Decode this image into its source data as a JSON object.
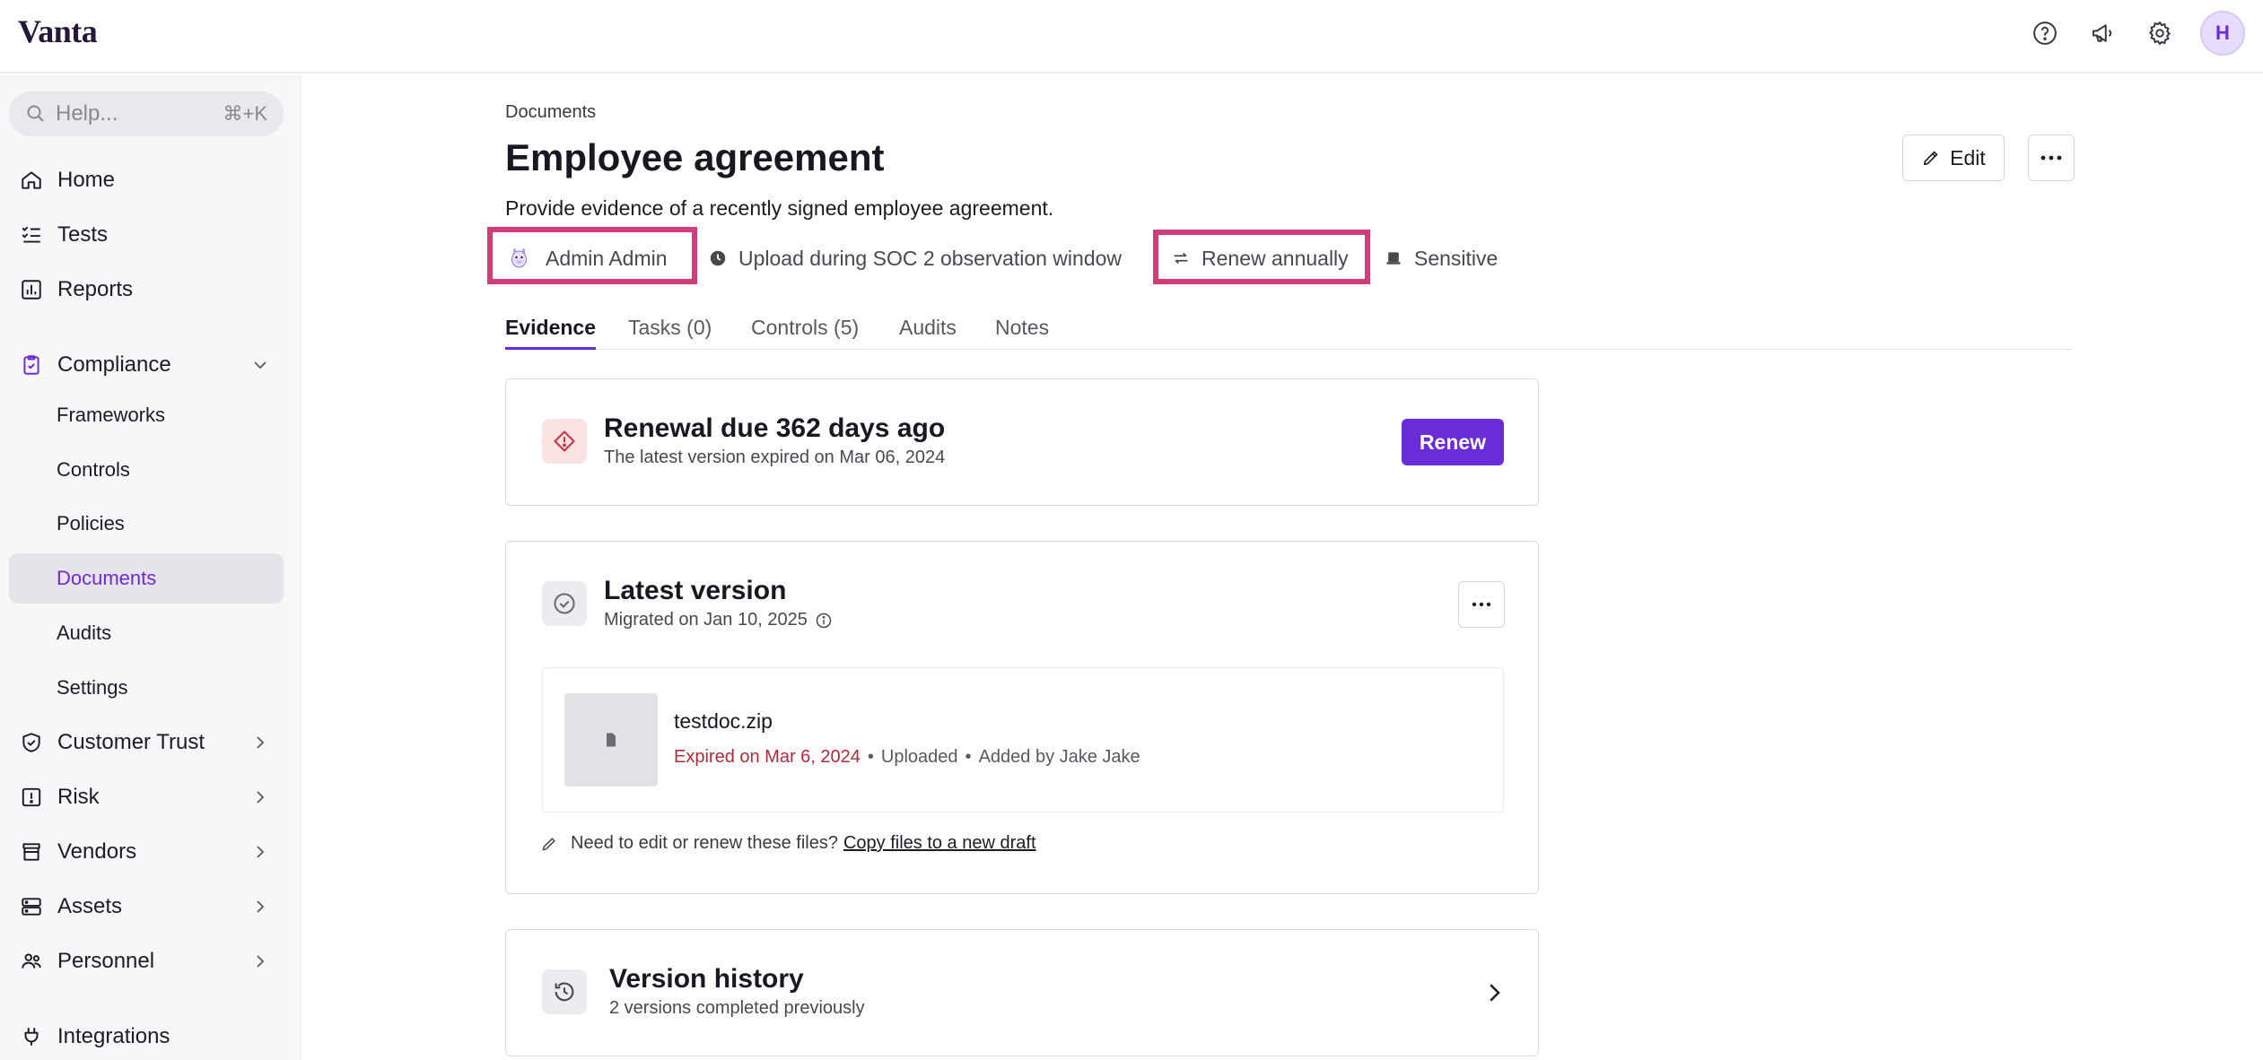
{
  "app": {
    "logo": "Vanta",
    "avatar_initial": "H"
  },
  "topbar": {
    "icons": [
      "help-icon",
      "megaphone-icon",
      "gear-icon"
    ]
  },
  "sidebar": {
    "search": {
      "placeholder": "Help...",
      "shortcut": "⌘+K"
    },
    "items": {
      "home": "Home",
      "tests": "Tests",
      "reports": "Reports",
      "compliance": "Compliance",
      "frameworks": "Frameworks",
      "controls": "Controls",
      "policies": "Policies",
      "documents": "Documents",
      "audits": "Audits",
      "settings": "Settings",
      "customer_trust": "Customer Trust",
      "risk": "Risk",
      "vendors": "Vendors",
      "assets": "Assets",
      "personnel": "Personnel",
      "integrations": "Integrations"
    }
  },
  "page": {
    "breadcrumb": "Documents",
    "title": "Employee agreement",
    "description": "Provide evidence of a recently signed employee agreement.",
    "edit_label": "Edit",
    "meta": {
      "owner": "Admin Admin",
      "upload_window": "Upload during SOC 2 observation window",
      "renewal": "Renew annually",
      "sensitivity": "Sensitive"
    },
    "tabs": [
      "Evidence",
      "Tasks (0)",
      "Controls (5)",
      "Audits",
      "Notes"
    ],
    "active_tab": "Evidence"
  },
  "renewal_card": {
    "title": "Renewal due 362 days ago",
    "subtitle": "The latest version expired on Mar 06, 2024",
    "button": "Renew"
  },
  "latest_version": {
    "title": "Latest version",
    "subtitle": "Migrated on Jan 10, 2025",
    "file": {
      "name": "testdoc.zip",
      "expired": "Expired on Mar 6, 2024",
      "status": "Uploaded",
      "added_by": "Added by Jake Jake"
    },
    "hint": "Need to edit or renew these files?",
    "hint_link": "Copy files to a new draft"
  },
  "version_history": {
    "title": "Version history",
    "subtitle": "2 versions completed previously"
  },
  "colors": {
    "accent": "#6a2bd8",
    "highlight": "#cf3e78",
    "expired": "#b42a3a",
    "warning_bg": "#fbe3e3"
  }
}
